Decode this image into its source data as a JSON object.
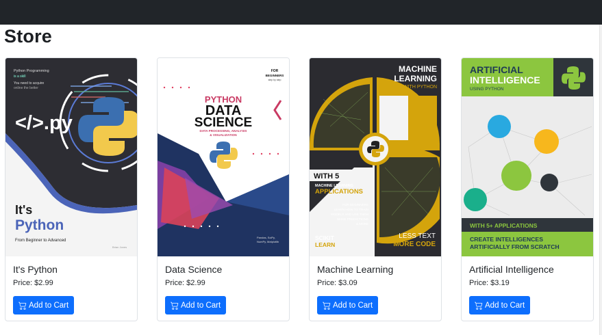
{
  "store": {
    "title": "Store"
  },
  "products": [
    {
      "name": "It's Python",
      "price": "Price: $2.99",
      "button": "Add to Cart",
      "cover": {
        "line1": "Python Programming",
        "line2": "is a skill",
        "line3": "You need to acquire",
        "line4": "online the better",
        "code": "</>.py",
        "title1": "It's",
        "title2": "Python",
        "subtitle": "From Beginner to Advanced",
        "author": "Brian Jones"
      }
    },
    {
      "name": "Data Science",
      "price": "Price: $2.99",
      "button": "Add to Cart",
      "cover": {
        "badge1": "FOR",
        "badge2": "BEGINNERS",
        "badge3": "step by step",
        "title1": "PYTHON",
        "title2": "DATA",
        "title3": "SCIENCE",
        "subtitle1": "DATA PROCESSING, ANALYSIS",
        "subtitle2": "& VISUALIZATION",
        "libs1": "Pandas, SciPy,",
        "libs2": "NumPy, Matplotlib"
      }
    },
    {
      "name": "Machine Learning",
      "price": "Price: $3.09",
      "button": "Add to Cart",
      "cover": {
        "title1": "MACHINE",
        "title2": "LEARNING",
        "title3": "WITH PYTHON",
        "with": "WITH 5",
        "ml": "MACHINE LEARNING",
        "apps": "APPLICATIONS",
        "desc1": "FOR BEGINNERS",
        "desc2": "LEARN HOW TO TRAIN",
        "desc3": "MODELS AND USE THEM",
        "desc4": "MAKE PREDICTIONS",
        "desc5": "& MORE",
        "scikit": "SCIKIT",
        "learn": "LEARN",
        "less": "LESS TEXT",
        "more": "MORE CODE"
      }
    },
    {
      "name": "Artificial Intelligence",
      "price": "Price: $3.19",
      "button": "Add to Cart",
      "cover": {
        "title1": "ARTIFICIAL",
        "title2": "INTELLIGENCE",
        "title3": "USING PYTHON",
        "with": "WITH 5+ APPLICATIONS",
        "create1": "CREATE INTELLIGENCES",
        "create2": "ARTIFICIALLY FROM SCRATCH"
      }
    }
  ],
  "colors": {
    "topbar": "#212529",
    "button": "#0d6efd"
  },
  "icons": {
    "button": "cart-icon"
  }
}
